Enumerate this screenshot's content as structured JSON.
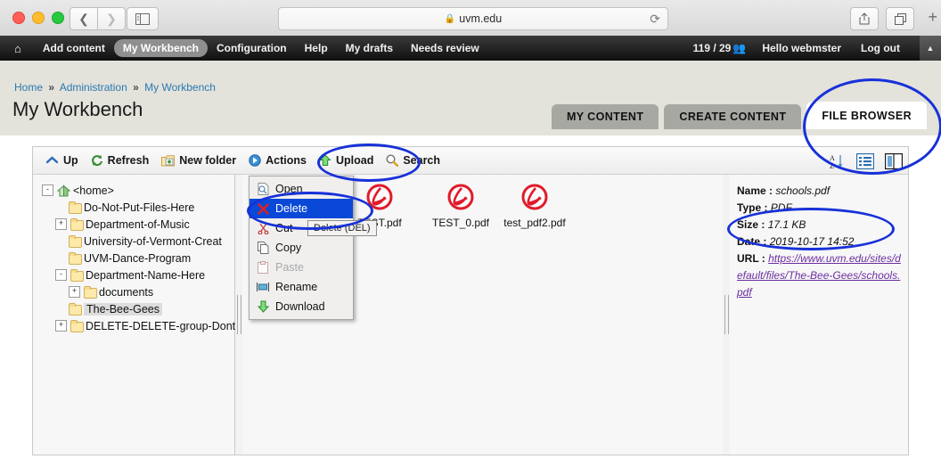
{
  "browser": {
    "url": "uvm.edu",
    "lock_icon": "lock-icon",
    "reload_icon": "reload-icon",
    "back_icon": "back-chevron-icon",
    "forward_icon": "forward-chevron-icon",
    "sidebar_icon": "sidebar-toggle-icon",
    "share_icon": "share-icon",
    "tabs_icon": "show-tabs-icon",
    "newtab_icon": "new-tab-icon"
  },
  "admin_toolbar": {
    "home_icon": "home-icon",
    "items": [
      {
        "label": "Add content",
        "active": false
      },
      {
        "label": "My Workbench",
        "active": true
      },
      {
        "label": "Configuration",
        "active": false
      },
      {
        "label": "Help",
        "active": false
      },
      {
        "label": "My drafts",
        "active": false
      },
      {
        "label": "Needs review",
        "active": false
      }
    ],
    "counter": "119 / 29",
    "people_icon": "people-icon",
    "greeting": "Hello webmster",
    "logout": "Log out",
    "collapse_icon": "collapse-triangle-icon"
  },
  "breadcrumb": {
    "items": [
      "Home",
      "Administration",
      "My Workbench"
    ],
    "separator": "»"
  },
  "page": {
    "title": "My Workbench"
  },
  "tabs": [
    {
      "label": "MY CONTENT",
      "active": false
    },
    {
      "label": "CREATE CONTENT",
      "active": false
    },
    {
      "label": "FILE BROWSER",
      "active": true
    }
  ],
  "filebrowser": {
    "toolbar": [
      {
        "label": "Up",
        "icon": "up-arrow-icon"
      },
      {
        "label": "Refresh",
        "icon": "refresh-icon"
      },
      {
        "label": "New folder",
        "icon": "new-folder-icon"
      },
      {
        "label": "Actions",
        "icon": "actions-icon"
      },
      {
        "label": "Upload",
        "icon": "upload-arrow-icon"
      },
      {
        "label": "Search",
        "icon": "search-icon"
      }
    ],
    "view_buttons": [
      {
        "name": "sort-az-icon"
      },
      {
        "name": "list-view-icon"
      },
      {
        "name": "split-view-icon"
      }
    ],
    "tree": [
      {
        "label": "<home>",
        "depth": 0,
        "expander": "-",
        "icon": "home-folder-icon",
        "selected": false
      },
      {
        "label": "Do-Not-Put-Files-Here",
        "depth": 1,
        "expander": "",
        "icon": "folder-icon",
        "selected": false
      },
      {
        "label": "Department-of-Music",
        "depth": 1,
        "expander": "+",
        "icon": "folder-icon",
        "selected": false
      },
      {
        "label": "University-of-Vermont-Creat",
        "depth": 1,
        "expander": "",
        "icon": "folder-icon",
        "selected": false
      },
      {
        "label": "UVM-Dance-Program",
        "depth": 1,
        "expander": "",
        "icon": "folder-icon",
        "selected": false
      },
      {
        "label": "Department-Name-Here",
        "depth": 1,
        "expander": "-",
        "icon": "folder-icon",
        "selected": false
      },
      {
        "label": "documents",
        "depth": 2,
        "expander": "+",
        "icon": "folder-icon",
        "selected": false
      },
      {
        "label": "The-Bee-Gees",
        "depth": 1,
        "expander": "",
        "icon": "folder-icon",
        "selected": true
      },
      {
        "label": "DELETE-DELETE-group-Dont",
        "depth": 1,
        "expander": "+",
        "icon": "folder-icon",
        "selected": false
      }
    ],
    "files": [
      {
        "name": "schools.pdf",
        "type": "pdf",
        "selected": true
      },
      {
        "name": "TEST.pdf",
        "type": "pdf",
        "selected": false
      },
      {
        "name": "TEST_0.pdf",
        "type": "pdf",
        "selected": false
      },
      {
        "name": "test_pdf2.pdf",
        "type": "pdf",
        "selected": false
      }
    ],
    "context_menu": {
      "items": [
        {
          "label": "Open",
          "icon": "open-icon",
          "state": "normal"
        },
        {
          "label": "Delete",
          "icon": "delete-x-icon",
          "state": "highlighted"
        },
        {
          "label": "Cut",
          "icon": "cut-scissors-icon",
          "state": "normal"
        },
        {
          "label": "Copy",
          "icon": "copy-icon",
          "state": "normal"
        },
        {
          "label": "Paste",
          "icon": "paste-icon",
          "state": "disabled"
        },
        {
          "label": "Rename",
          "icon": "rename-icon",
          "state": "normal"
        },
        {
          "label": "Download",
          "icon": "download-arrow-icon",
          "state": "normal"
        }
      ],
      "tooltip": "Delete (DEL)"
    },
    "info": {
      "name_key": "Name :",
      "name_value": "schools.pdf",
      "type_key": "Type :",
      "type_value": "PDF",
      "size_key": "Size :",
      "size_value": "17.1 KB",
      "date_key": "Date :",
      "date_value": "2019-10-17 14:52",
      "url_key": "URL :",
      "url_value": "https://www.uvm.edu/sites/default/files/The-Bee-Gees/schools.pdf"
    }
  },
  "annotations": {
    "color": "#1731d8",
    "targets": [
      "file-browser-tab",
      "upload-button",
      "delete-menu-item",
      "size-and-date-fields"
    ]
  }
}
